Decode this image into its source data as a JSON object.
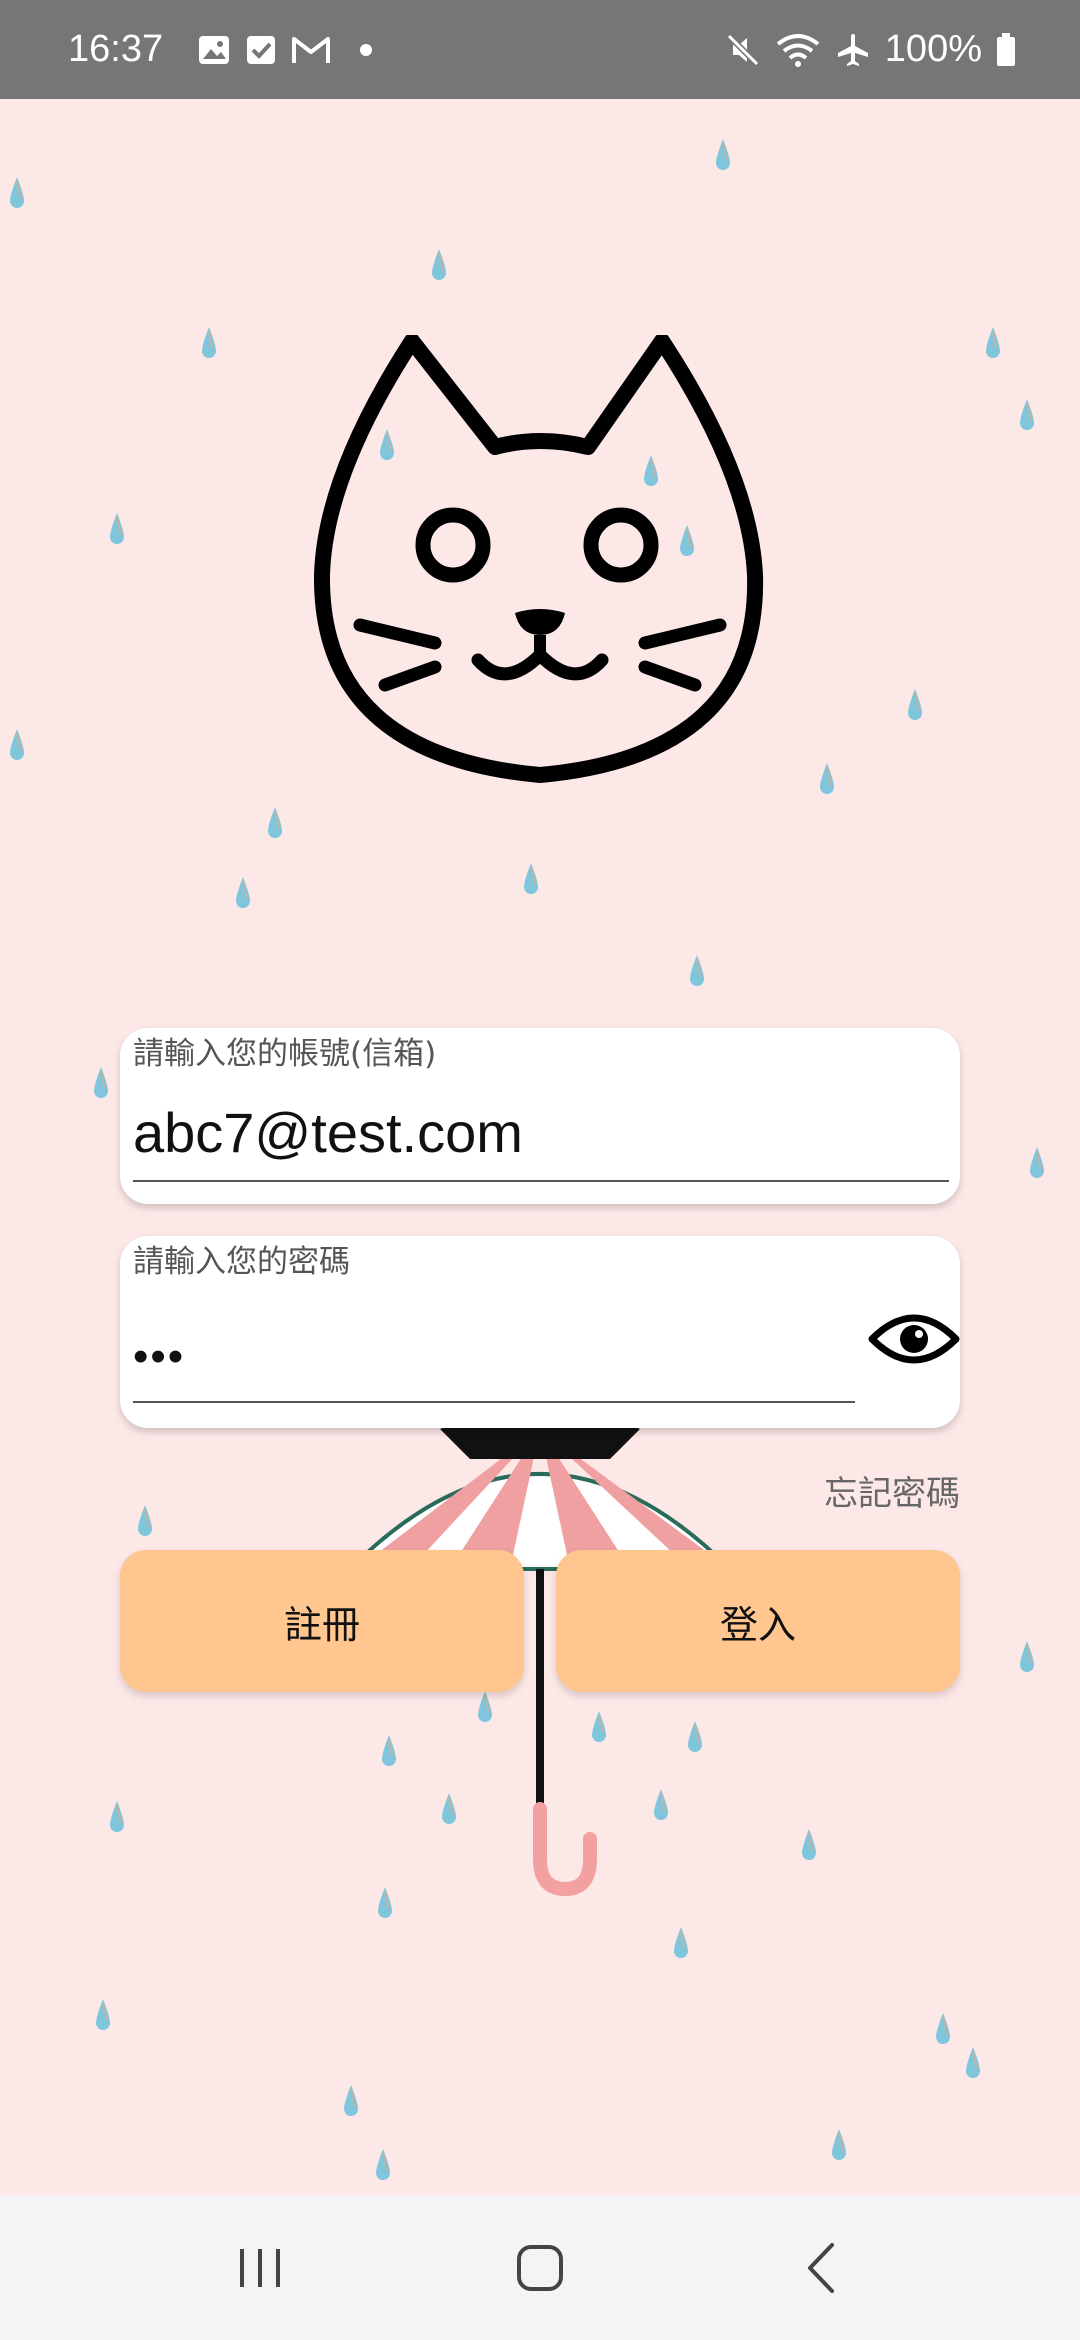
{
  "status_bar": {
    "time": "16:37",
    "battery_percent": "100%",
    "left_icons": [
      "gallery-icon",
      "tasks-check-icon",
      "gmail-icon",
      "notification-dot-icon"
    ],
    "right_icons": [
      "mute-icon",
      "wifi-icon",
      "airplane-icon",
      "battery-icon"
    ]
  },
  "login_form": {
    "email": {
      "label": "請輸入您的帳號(信箱)",
      "value": "abc7@test.com"
    },
    "password": {
      "label": "請輸入您的密碼",
      "value": "•••",
      "toggle_icon": "eye-icon"
    },
    "forgot_password": "忘記密碼",
    "register_button": "註冊",
    "login_button": "登入"
  },
  "colors": {
    "background": "#fde8e8",
    "button": "#ffc690",
    "status_bar": "#767676",
    "nav_bar": "#f4f4f6"
  },
  "nav_bar": {
    "icons": [
      "recent-apps-icon",
      "home-icon",
      "back-icon"
    ]
  }
}
